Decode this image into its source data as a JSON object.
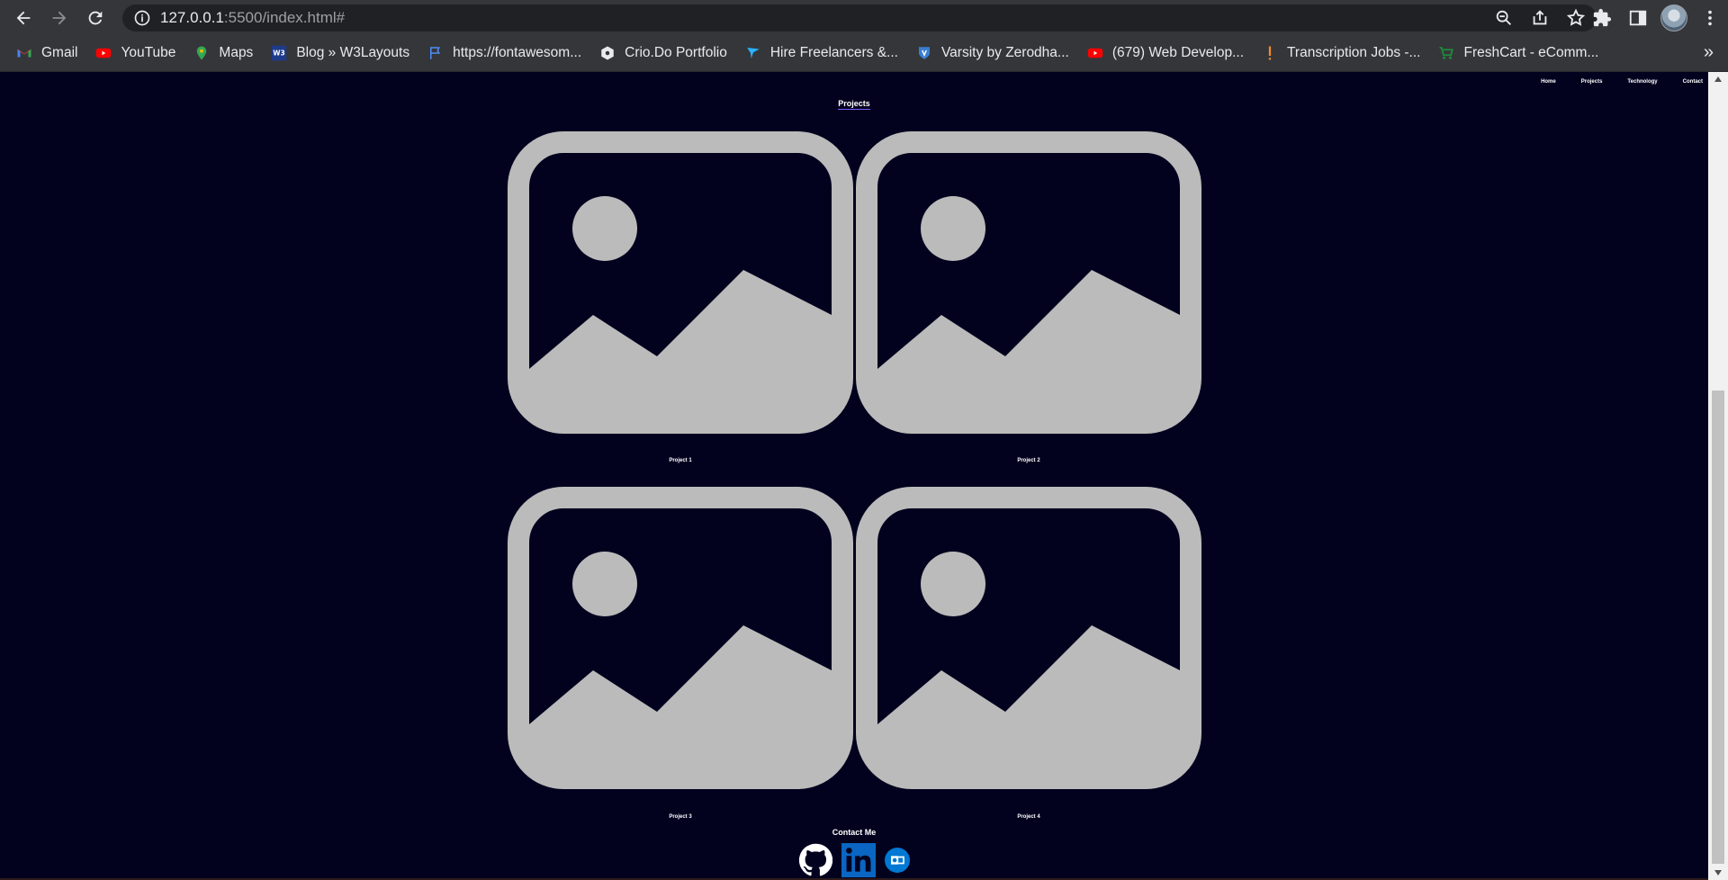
{
  "browser": {
    "url_host": "127.0.0.1",
    "url_path": ":5500/index.html#"
  },
  "bookmarks": [
    {
      "label": "Gmail",
      "icon": "gmail-icon",
      "color": "#ea4335"
    },
    {
      "label": "YouTube",
      "icon": "youtube-icon",
      "color": "#ff0000"
    },
    {
      "label": "Maps",
      "icon": "maps-icon",
      "color": "#34a853"
    },
    {
      "label": "Blog » W3Layouts",
      "icon": "w3layouts-icon",
      "color": "#1e3a8a"
    },
    {
      "label": "https://fontawesom...",
      "icon": "flag-icon",
      "color": "#4d8ef7"
    },
    {
      "label": "Crio.Do Portfolio",
      "icon": "crio-icon",
      "color": "#e8eaed"
    },
    {
      "label": "Hire Freelancers &...",
      "icon": "freelancer-icon",
      "color": "#29b2fe"
    },
    {
      "label": "Varsity by Zerodha...",
      "icon": "varsity-icon",
      "color": "#387ed1"
    },
    {
      "label": "(679) Web Develop...",
      "icon": "youtube-icon",
      "color": "#ff0000"
    },
    {
      "label": "Transcription Jobs -...",
      "icon": "exclamation-icon",
      "color": "#f28b28"
    },
    {
      "label": "FreshCart - eComm...",
      "icon": "freshcart-icon",
      "color": "#1f8a3a"
    }
  ],
  "site": {
    "nav": [
      "Home",
      "Projects",
      "Technology",
      "Contact"
    ],
    "projects_title": "Projects",
    "projects": [
      {
        "label": "Project 1"
      },
      {
        "label": "Project 2"
      },
      {
        "label": "Project 3"
      },
      {
        "label": "Project 4"
      }
    ],
    "contact_title": "Contact Me",
    "socials": [
      {
        "icon": "github-icon"
      },
      {
        "icon": "linkedin-icon"
      },
      {
        "icon": "outlook-icon"
      }
    ]
  },
  "colors": {
    "page_background": "#02021f",
    "placeholder_gray": "#bbbbbb",
    "linkedin_blue": "#0a66c2",
    "outlook_blue": "#0078d4"
  }
}
